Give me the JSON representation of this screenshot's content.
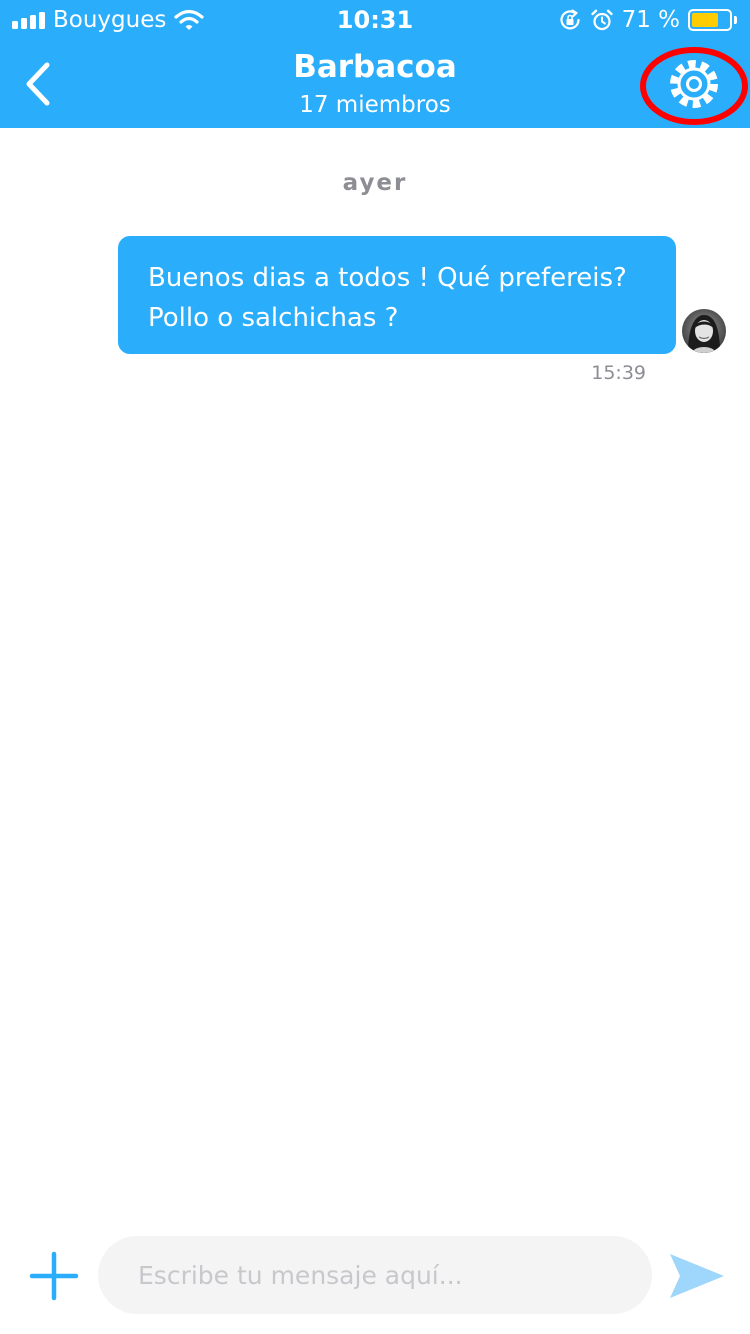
{
  "status_bar": {
    "carrier": "Bouygues",
    "time": "10:31",
    "battery_percent": "71 %",
    "battery_level": 0.71,
    "battery_color": "#ffcc00",
    "icons": [
      "signal-icon",
      "wifi-icon",
      "orientation-lock-icon",
      "alarm-icon",
      "battery-icon"
    ]
  },
  "nav": {
    "title": "Barbacoa",
    "subtitle": "17 miembros",
    "back_icon": "chevron-left-icon",
    "settings_icon": "gear-icon",
    "settings_highlight_color": "#ff0000"
  },
  "chat": {
    "date_separator": "ayer",
    "messages": [
      {
        "text": "Buenos dias a todos ! Qué prefereis?\nPollo o salchichas ?",
        "time": "15:39",
        "outgoing": true
      }
    ]
  },
  "composer": {
    "placeholder": "Escribe tu mensaje aquí...",
    "value": "",
    "add_icon": "plus-icon",
    "send_icon": "send-icon"
  },
  "colors": {
    "primary": "#2aadfb",
    "bubble_text": "#ffffff",
    "muted_text": "#8d8d94",
    "input_background": "#f4f4f5",
    "send_icon": "#9fd6fb"
  }
}
